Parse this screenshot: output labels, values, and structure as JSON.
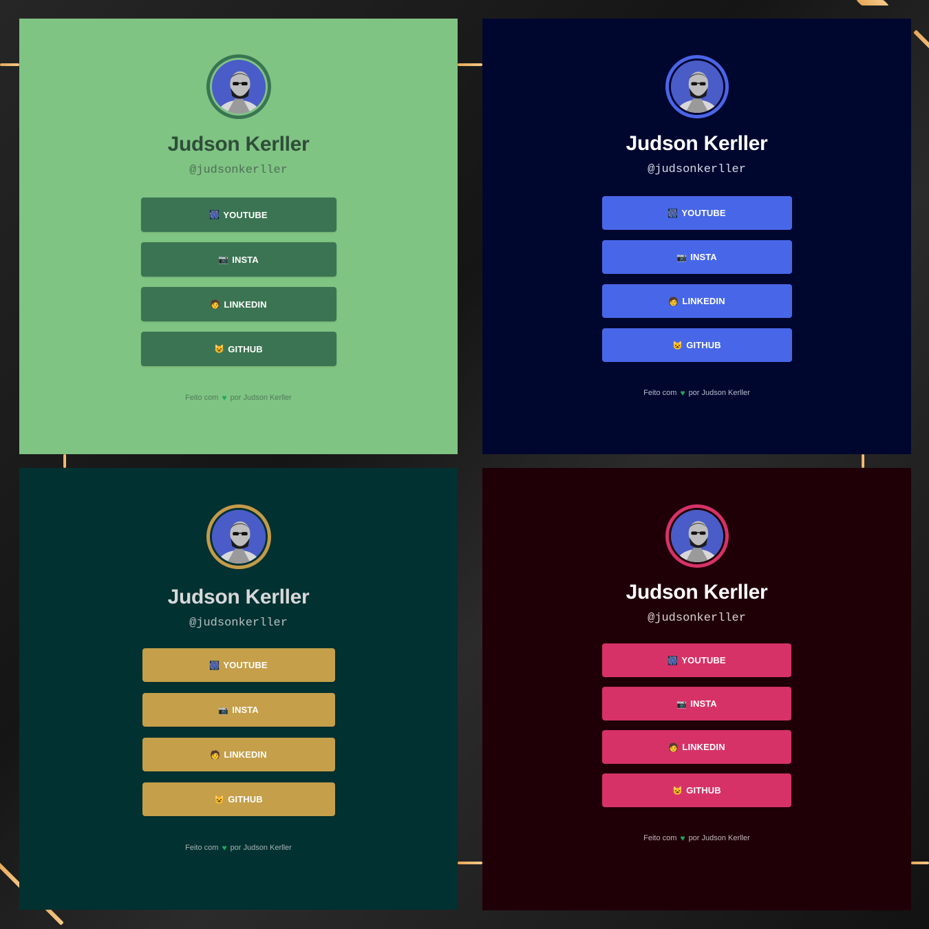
{
  "profile": {
    "name": "Judson Kerller",
    "handle": "@judsonkerller"
  },
  "links": [
    {
      "label": "YOUTUBE",
      "icon": "🎆"
    },
    {
      "label": "INSTA",
      "icon": "📷"
    },
    {
      "label": "LINKEDIN",
      "icon": "🧑"
    },
    {
      "label": "GITHUB",
      "icon": "😺"
    }
  ],
  "footer": {
    "before": "Feito com",
    "heart": "♥",
    "after": "por Judson Kerller"
  },
  "themes": [
    {
      "id": "green",
      "background": "#7fc483",
      "ring": "#3a7552",
      "name_color": "#2f4d3a",
      "handle_color": "#4f6e57",
      "button": "#3b7452",
      "footer_color": "#4f7a5a"
    },
    {
      "id": "navy",
      "background": "#00072e",
      "ring": "#4a65e8",
      "name_color": "#ffffff",
      "handle_color": "#d6d9e6",
      "button": "#4767e8",
      "footer_color": "#b8bccc"
    },
    {
      "id": "teal",
      "background": "#013131",
      "ring": "#c49a49",
      "name_color": "#d8d8d8",
      "handle_color": "#b7c0bf",
      "button": "#c59f4a",
      "footer_color": "#a8b4b3"
    },
    {
      "id": "maroon",
      "background": "#200007",
      "ring": "#d73268",
      "name_color": "#ffffff",
      "handle_color": "#d9d2d4",
      "button": "#d73267",
      "footer_color": "#c0b8ba"
    }
  ]
}
